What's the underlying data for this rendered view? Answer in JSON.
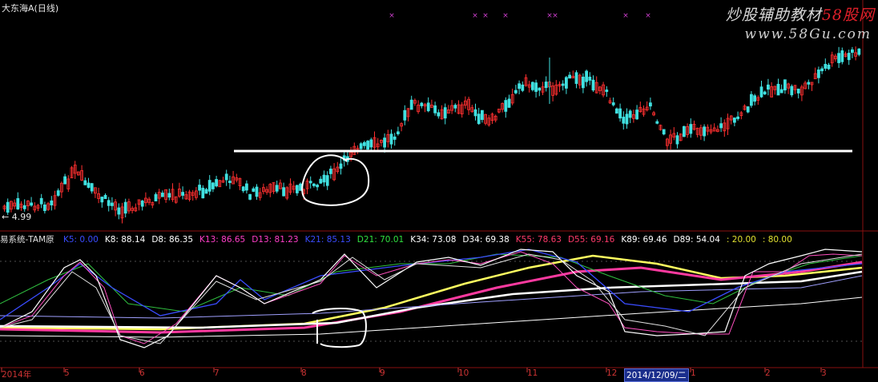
{
  "header": {
    "stock_title": "大东海A(日线)",
    "low_price_label": "← 4.99"
  },
  "watermark": {
    "brand_prefix": "炒股辅助教材",
    "brand_site": "58股网",
    "url": "www.58Gu.com"
  },
  "indicator": {
    "name": "易系统-TAM原",
    "values": [
      {
        "label": "K5: 0.00",
        "color": "#3a4cff"
      },
      {
        "label": "K8: 88.14",
        "color": "#ffffff"
      },
      {
        "label": "D8: 86.35",
        "color": "#ffffff"
      },
      {
        "label": "K13: 86.65",
        "color": "#ff3ec8"
      },
      {
        "label": "D13: 81.23",
        "color": "#ff3ec8"
      },
      {
        "label": "K21: 85.13",
        "color": "#3a4cff"
      },
      {
        "label": "D21: 70.01",
        "color": "#30e040"
      },
      {
        "label": "K34: 73.08",
        "color": "#ffffff"
      },
      {
        "label": "D34: 69.38",
        "color": "#ffffff"
      },
      {
        "label": "K55: 78.63",
        "color": "#ff3a6a"
      },
      {
        "label": "D55: 69.16",
        "color": "#ff3a6a"
      },
      {
        "label": "K89: 69.46",
        "color": "#ffffff"
      },
      {
        "label": "D89: 54.04",
        "color": "#ffffff"
      },
      {
        "label": ": 20.00",
        "color": "#e0e030"
      },
      {
        "label": ": 80.00",
        "color": "#e0e030"
      }
    ]
  },
  "date_axis": {
    "labels": [
      "2014年",
      "5",
      "6",
      "7",
      "8",
      "9",
      "10",
      "11",
      "12",
      "1",
      "2",
      "3"
    ],
    "cursor_date": "2014/12/09/二"
  },
  "colors": {
    "up_candle": "#ff3030",
    "down_candle": "#40e0e0",
    "support_line": "#ffffff",
    "annotation_circle": "#ffffff",
    "marker_x": "#d040d0"
  }
}
